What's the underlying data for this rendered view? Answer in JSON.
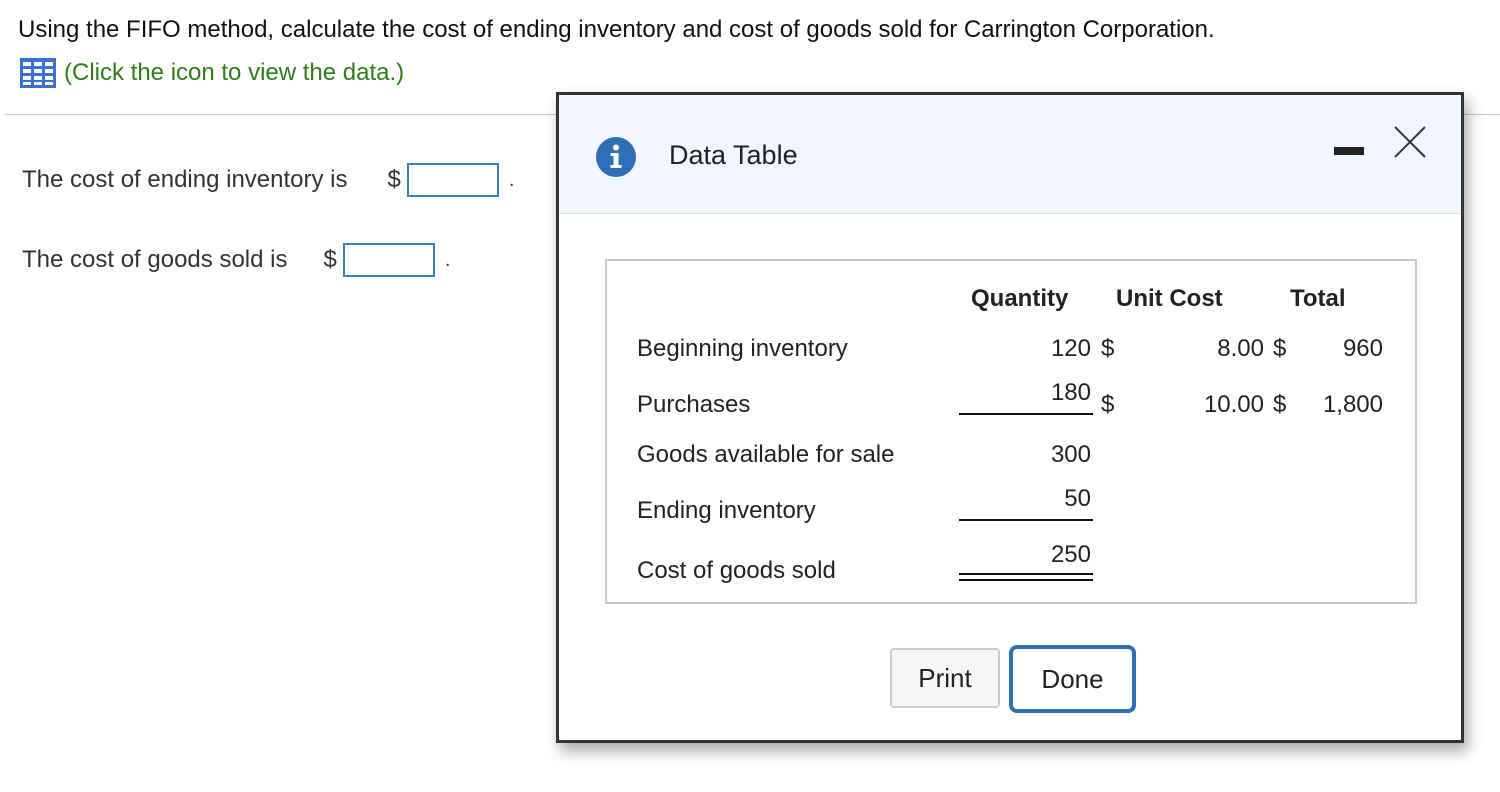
{
  "question": {
    "text": "Using the FIFO method, calculate the cost of ending inventory and cost of goods sold for Carrington Corporation.",
    "data_link_text": "(Click the icon to view the data.)",
    "link_color": "#2f7d1a"
  },
  "answers": {
    "ending_inventory_label": "The cost of ending inventory is",
    "cogs_label": "The cost of goods sold is",
    "currency": "$",
    "ending_inventory_value": "",
    "cogs_value": "",
    "period": "."
  },
  "dialog": {
    "title": "Data Table",
    "icons": [
      "info-icon",
      "minimize-icon",
      "close-icon"
    ],
    "accent_color": "#2f6fb5",
    "header_bg": "#f1f5fc"
  },
  "data_table": {
    "headers": {
      "quantity": "Quantity",
      "unit_cost": "Unit Cost",
      "total": "Total"
    },
    "rows": [
      {
        "label": "Beginning inventory",
        "quantity": "120",
        "unit_cost_currency": "$",
        "unit_cost": "8.00",
        "total_currency": "$",
        "total": "960"
      },
      {
        "label": "Purchases",
        "quantity": "180",
        "unit_cost_currency": "$",
        "unit_cost": "10.00",
        "total_currency": "$",
        "total": "1,800"
      },
      {
        "label": "Goods available for sale",
        "quantity": "300"
      },
      {
        "label": "Ending inventory",
        "quantity": "50"
      },
      {
        "label": "Cost of goods sold",
        "quantity": "250"
      }
    ]
  },
  "buttons": {
    "print": "Print",
    "done": "Done"
  }
}
